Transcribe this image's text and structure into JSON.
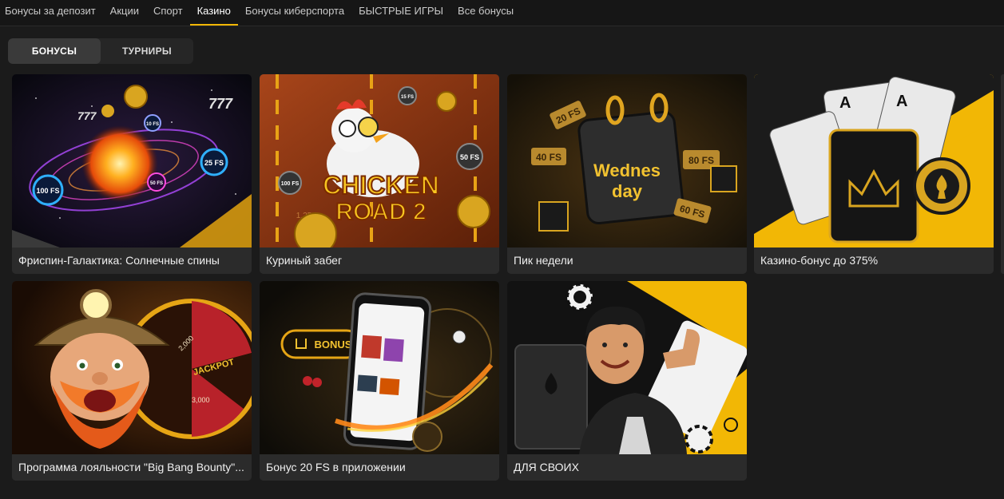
{
  "nav": {
    "items": [
      {
        "label": "Бонусы за депозит"
      },
      {
        "label": "Акции"
      },
      {
        "label": "Спорт"
      },
      {
        "label": "Казино",
        "active": true
      },
      {
        "label": "Бонусы киберспорта"
      },
      {
        "label": "БЫСТРЫЕ ИГРЫ"
      },
      {
        "label": "Все бонусы"
      }
    ],
    "accent_color": "#f2b705"
  },
  "tabs": [
    {
      "label": "БОНУСЫ",
      "selected": true
    },
    {
      "label": "ТУРНИРЫ"
    }
  ],
  "cards": [
    {
      "title": "Фриспин-Галактика: Солнечные спины",
      "art_text": [
        "100 FS",
        "25 FS",
        "50 FS",
        "10 FS",
        "777"
      ]
    },
    {
      "title": "Куриный забег",
      "art_text": [
        "CHICKEN",
        "ROAD 2",
        "15 FS",
        "50 FS",
        "100 FS",
        "1.25x"
      ]
    },
    {
      "title": "Пик недели",
      "art_text": [
        "Wednes",
        "day",
        "20 FS",
        "40 FS",
        "80 FS",
        "60 FS"
      ]
    },
    {
      "title": "Казино-бонус до 375%",
      "art_text": [
        "A",
        "A"
      ]
    },
    {
      "title": "Программа лояльности \"Big Bang Bounty\"...",
      "art_text": [
        "JACKPOT",
        "2,000",
        "3,000"
      ]
    },
    {
      "title": "Бонус 20 FS в приложении",
      "art_text": [
        "BONUS"
      ]
    },
    {
      "title": "ДЛЯ СВОИХ",
      "art_text": []
    }
  ]
}
